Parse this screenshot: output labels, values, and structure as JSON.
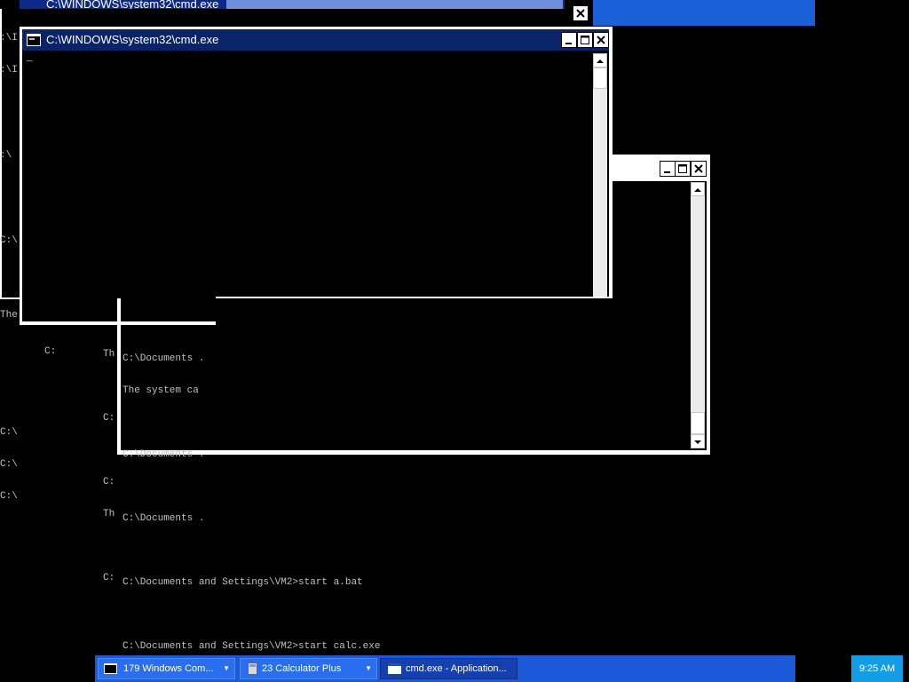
{
  "windows": {
    "top_partial": {
      "title": "C:\\WINDOWS\\system32\\cmd.exe"
    },
    "front": {
      "title": "C:\\WINDOWS\\system32\\cmd.exe",
      "cursor": "_"
    },
    "left_behind": {
      "lines": [
        ":\\I",
        ":\\I",
        ":\\",
        "C:\\",
        "The",
        "C:\\",
        "C:\\",
        "C:\\"
      ]
    },
    "middle_behind": {
      "lines": [
        "C:",
        "Th",
        "C:",
        "C:",
        "Th",
        "C:"
      ]
    },
    "right": {
      "lines": [
        "C:\\Documents .",
        "The system ca",
        "C:\\Documents .",
        "C:\\Documents .",
        "C:\\Documents and Settings\\VM2>start a.bat",
        "C:\\Documents and Settings\\VM2>start calc.exe"
      ]
    }
  },
  "taskbar": {
    "buttons": [
      {
        "label": "179 Windows Com...",
        "arrow": "▼",
        "icon": "cmd-icon"
      },
      {
        "label": "23 Calculator Plus",
        "arrow": "▼",
        "icon": "calculator-icon"
      },
      {
        "label": "cmd.exe - Application...",
        "icon": "application-icon"
      }
    ]
  },
  "clock": {
    "time": "9:25 AM"
  },
  "colors": {
    "taskbar": "#1b59d8",
    "tray": "#119ee6",
    "active_title": "#0a246a",
    "terminal_text": "#c0c0c0"
  }
}
